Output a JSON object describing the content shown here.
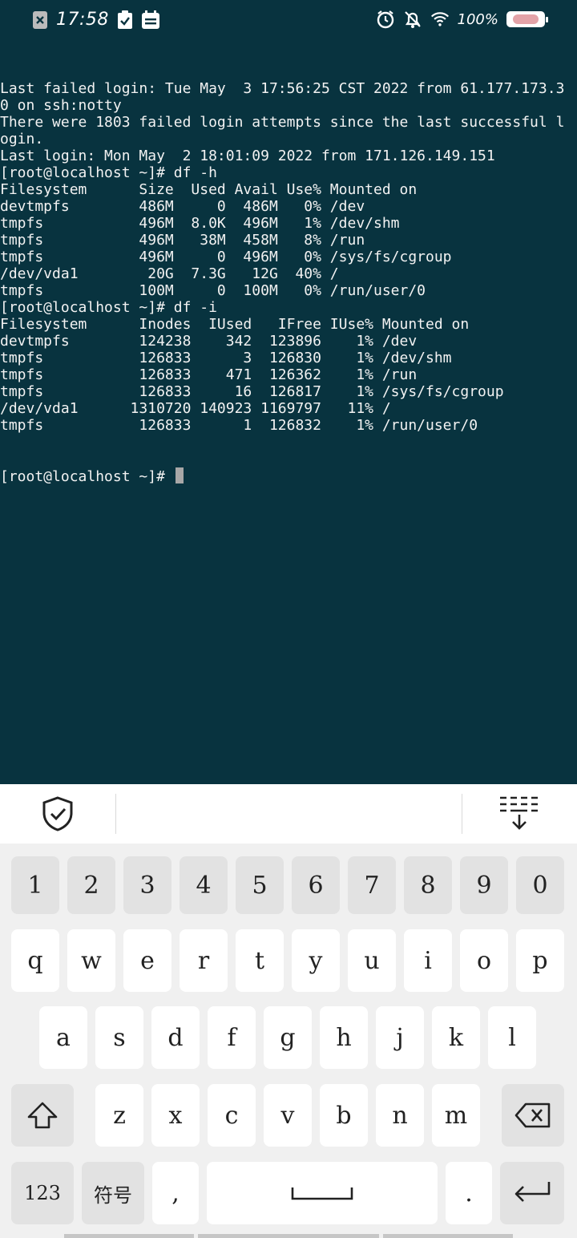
{
  "status_bar": {
    "time": "17:58",
    "battery_text": "100%",
    "icons_left": [
      "close-notification-icon",
      "clipboard-check-icon",
      "calendar-icon"
    ],
    "icons_right": [
      "alarm-icon",
      "bell-off-icon",
      "wifi-icon",
      "battery-icon"
    ]
  },
  "terminal": {
    "lines": [
      "Last failed login: Tue May  3 17:56:25 CST 2022 from 61.177.173.3",
      "0 on ssh:notty",
      "There were 1803 failed login attempts since the last successful l",
      "ogin.",
      "Last login: Mon May  2 18:01:09 2022 from 171.126.149.151",
      "[root@localhost ~]# df -h",
      "Filesystem      Size  Used Avail Use% Mounted on",
      "devtmpfs        486M     0  486M   0% /dev",
      "tmpfs           496M  8.0K  496M   1% /dev/shm",
      "tmpfs           496M   38M  458M   8% /run",
      "tmpfs           496M     0  496M   0% /sys/fs/cgroup",
      "/dev/vda1        20G  7.3G   12G  40% /",
      "tmpfs           100M     0  100M   0% /run/user/0",
      "[root@localhost ~]# df -i",
      "Filesystem      Inodes  IUsed   IFree IUse% Mounted on",
      "devtmpfs        124238    342  123896    1% /dev",
      "tmpfs           126833      3  126830    1% /dev/shm",
      "tmpfs           126833    471  126362    1% /run",
      "tmpfs           126833     16  126817    1% /sys/fs/cgroup",
      "/dev/vda1      1310720 140923 1169797   11% /",
      "tmpfs           126833      1  126832    1% /run/user/0"
    ],
    "prompt": "[root@localhost ~]# "
  },
  "keyboard": {
    "toolbar": {
      "left_icon": "shield-check-icon",
      "right_icon": "collapse-keyboard-icon"
    },
    "row_numbers": [
      "1",
      "2",
      "3",
      "4",
      "5",
      "6",
      "7",
      "8",
      "9",
      "0"
    ],
    "row1": [
      "q",
      "w",
      "e",
      "r",
      "t",
      "y",
      "u",
      "i",
      "o",
      "p"
    ],
    "row2": [
      "a",
      "s",
      "d",
      "f",
      "g",
      "h",
      "j",
      "k",
      "l"
    ],
    "row3": [
      "z",
      "x",
      "c",
      "v",
      "b",
      "n",
      "m"
    ],
    "bottom": {
      "num_label": "123",
      "symbol_label": "符号",
      "comma": ",",
      "period": "."
    }
  }
}
